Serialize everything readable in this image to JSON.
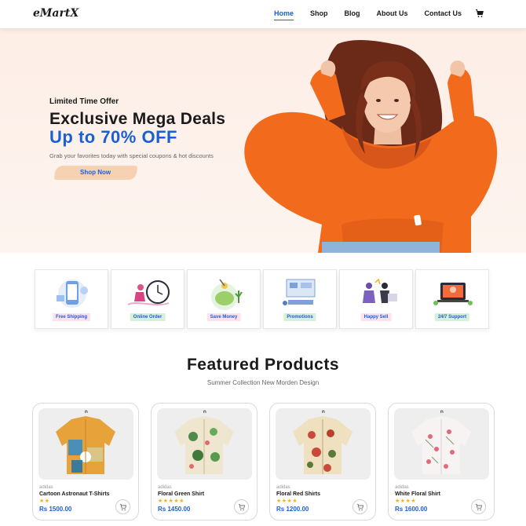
{
  "brand": {
    "logo": "eMartX"
  },
  "nav": {
    "links": [
      {
        "label": "Home",
        "active": true
      },
      {
        "label": "Shop"
      },
      {
        "label": "Blog"
      },
      {
        "label": "About Us"
      },
      {
        "label": "Contact Us"
      }
    ],
    "cart_icon": "cart-icon"
  },
  "hero": {
    "kicker": "Limited Time Offer",
    "title": "Exclusive Mega Deals",
    "highlight": "Up to 70% OFF",
    "description": "Grab your favorites today with special coupons & hot discounts",
    "cta": "Shop Now"
  },
  "features": [
    {
      "label": "Free Shipping",
      "badge_bg": "#fde2ea",
      "badge_color": "#1a5fd6",
      "icon": "phone-delivery-illustration"
    },
    {
      "label": "Online Order",
      "badge_bg": "#d8f0d8",
      "badge_color": "#1a5fd6",
      "icon": "clock-runner-illustration"
    },
    {
      "label": "Save Money",
      "badge_bg": "#fde2ea",
      "badge_color": "#1a5fd6",
      "icon": "piggy-bank-illustration"
    },
    {
      "label": "Promotions",
      "badge_bg": "#d8f0d8",
      "badge_color": "#1a5fd6",
      "icon": "promotion-board-illustration"
    },
    {
      "label": "Happy Sell",
      "badge_bg": "#fde2ea",
      "badge_color": "#1a5fd6",
      "icon": "happy-people-illustration"
    },
    {
      "label": "24/7 Support",
      "badge_bg": "#d8f0d8",
      "badge_color": "#1a5fd6",
      "icon": "support-laptop-illustration"
    }
  ],
  "featured": {
    "title": "Featured Products",
    "subtitle": "Summer Collection New Morden Design"
  },
  "products": [
    {
      "brand": "adidas",
      "name": "Cartoon Astronaut T-Shirts",
      "stars": "★★",
      "price": "Rs 1500.00"
    },
    {
      "brand": "adidas",
      "name": "Floral Green Shirt",
      "stars": "★★★★★",
      "price": "Rs 1450.00"
    },
    {
      "brand": "adidas",
      "name": "Floral Red Shirts",
      "stars": "★★★★",
      "price": "Rs 1200.00"
    },
    {
      "brand": "adidas",
      "name": "White Floral Shirt",
      "stars": "★★★★",
      "price": "Rs 1600.00"
    }
  ],
  "colors": {
    "accent": "#1a5fd6",
    "hero_bg": "#fdeee6",
    "hoodie": "#f26b1d",
    "star": "#f2b01e"
  }
}
